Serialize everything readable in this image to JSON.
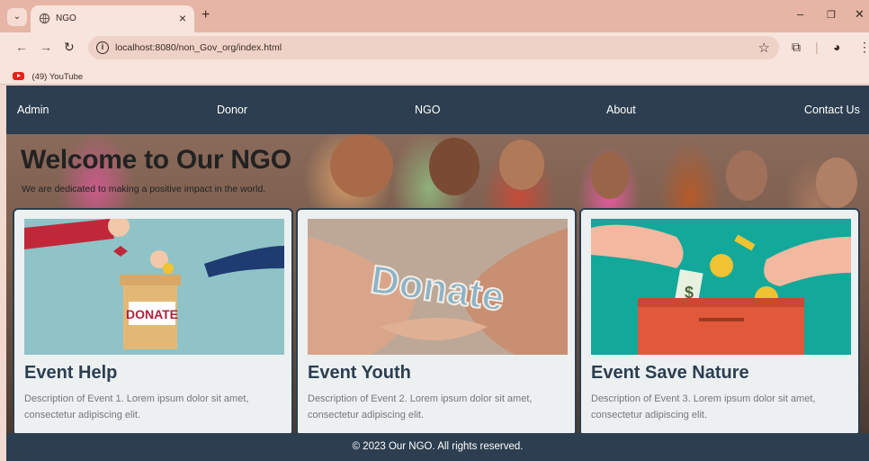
{
  "browser": {
    "tab_title": "NGO",
    "tab_close": "×",
    "new_tab": "+",
    "url": "localhost:8080/non_Gov_org/index.html",
    "bookmark": "(49) YouTube",
    "icons": [
      "chevron-down-icon",
      "globe-icon",
      "close-icon",
      "plus-icon",
      "back-icon",
      "forward-icon",
      "reload-icon",
      "info-icon",
      "star-icon",
      "extensions-icon",
      "profile-icon",
      "kebab-menu-icon",
      "youtube-icon"
    ]
  },
  "nav": {
    "items": [
      "Admin",
      "Donor",
      "NGO",
      "About",
      "Contact Us"
    ]
  },
  "hero": {
    "title": "Welcome to Our NGO",
    "subtitle": "We are dedicated to making a positive impact in the world."
  },
  "cards": [
    {
      "title": "Event Help",
      "description": "Description of Event 1. Lorem ipsum dolor sit amet, consectetur adipiscing elit.",
      "image_text": "DONATE"
    },
    {
      "title": "Event Youth",
      "description": "Description of Event 2. Lorem ipsum dolor sit amet, consectetur adipiscing elit.",
      "image_text": "Donate"
    },
    {
      "title": "Event Save Nature",
      "description": "Description of Event 3. Lorem ipsum dolor sit amet, consectetur adipiscing elit.",
      "image_text": "$"
    }
  ],
  "footer": {
    "text": "© 2023 Our NGO. All rights reserved."
  },
  "colors": {
    "nav_bg": "#2c3e50",
    "card_bg": "#ecf0f1",
    "browser_frame": "#e6b5a5"
  }
}
